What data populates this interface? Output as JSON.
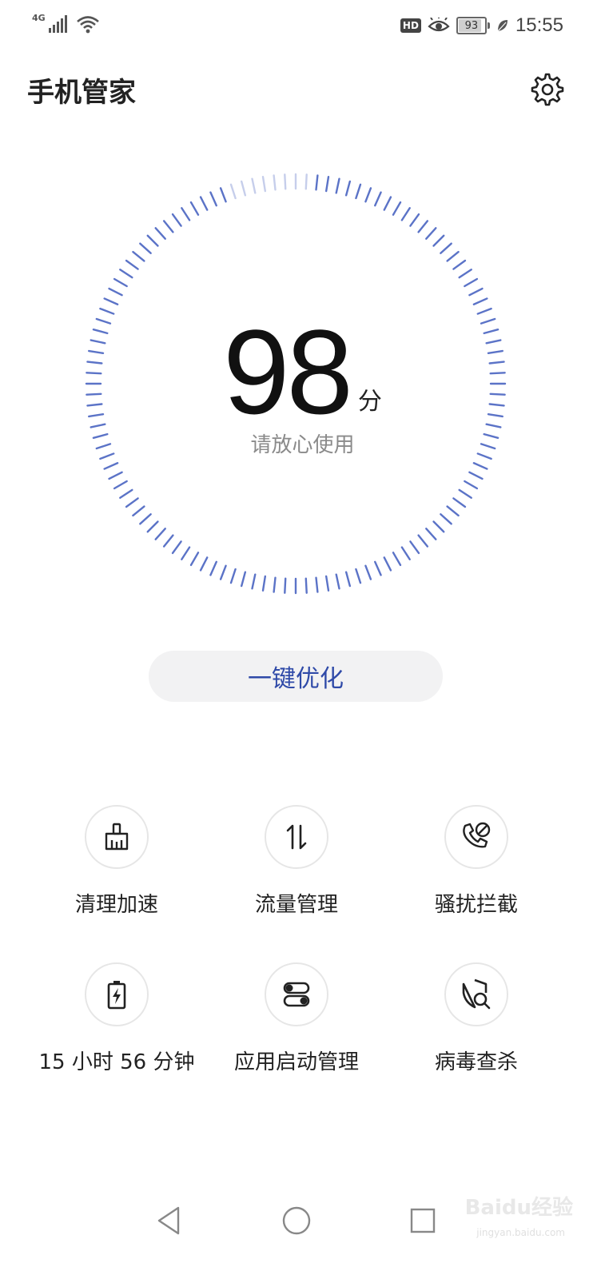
{
  "status_bar": {
    "network": "4G",
    "battery": "93",
    "time": "15:55",
    "hd": "HD",
    "icons": [
      "signal-icon",
      "wifi-icon",
      "eye-comfort-icon",
      "leaf-icon"
    ]
  },
  "header": {
    "title": "手机管家",
    "settings_icon": "gear-icon"
  },
  "score": {
    "value": "98",
    "unit": "分",
    "status": "请放心使用",
    "accent": "#5b73c7"
  },
  "optimize_button": {
    "label": "一键优化",
    "color": "#2f4aa8"
  },
  "tools": [
    {
      "label": "清理加速",
      "icon": "broom-icon"
    },
    {
      "label": "流量管理",
      "icon": "data-transfer-icon"
    },
    {
      "label": "骚扰拦截",
      "icon": "block-call-icon"
    },
    {
      "label": "15 小时 56 分钟",
      "icon": "battery-icon"
    },
    {
      "label": "应用启动管理",
      "icon": "toggles-icon"
    },
    {
      "label": "病毒查杀",
      "icon": "shield-search-icon"
    }
  ],
  "nav": [
    "back-icon",
    "home-icon",
    "recents-icon"
  ],
  "watermark": {
    "text": "Baidu经验",
    "sub": "jingyan.baidu.com"
  }
}
